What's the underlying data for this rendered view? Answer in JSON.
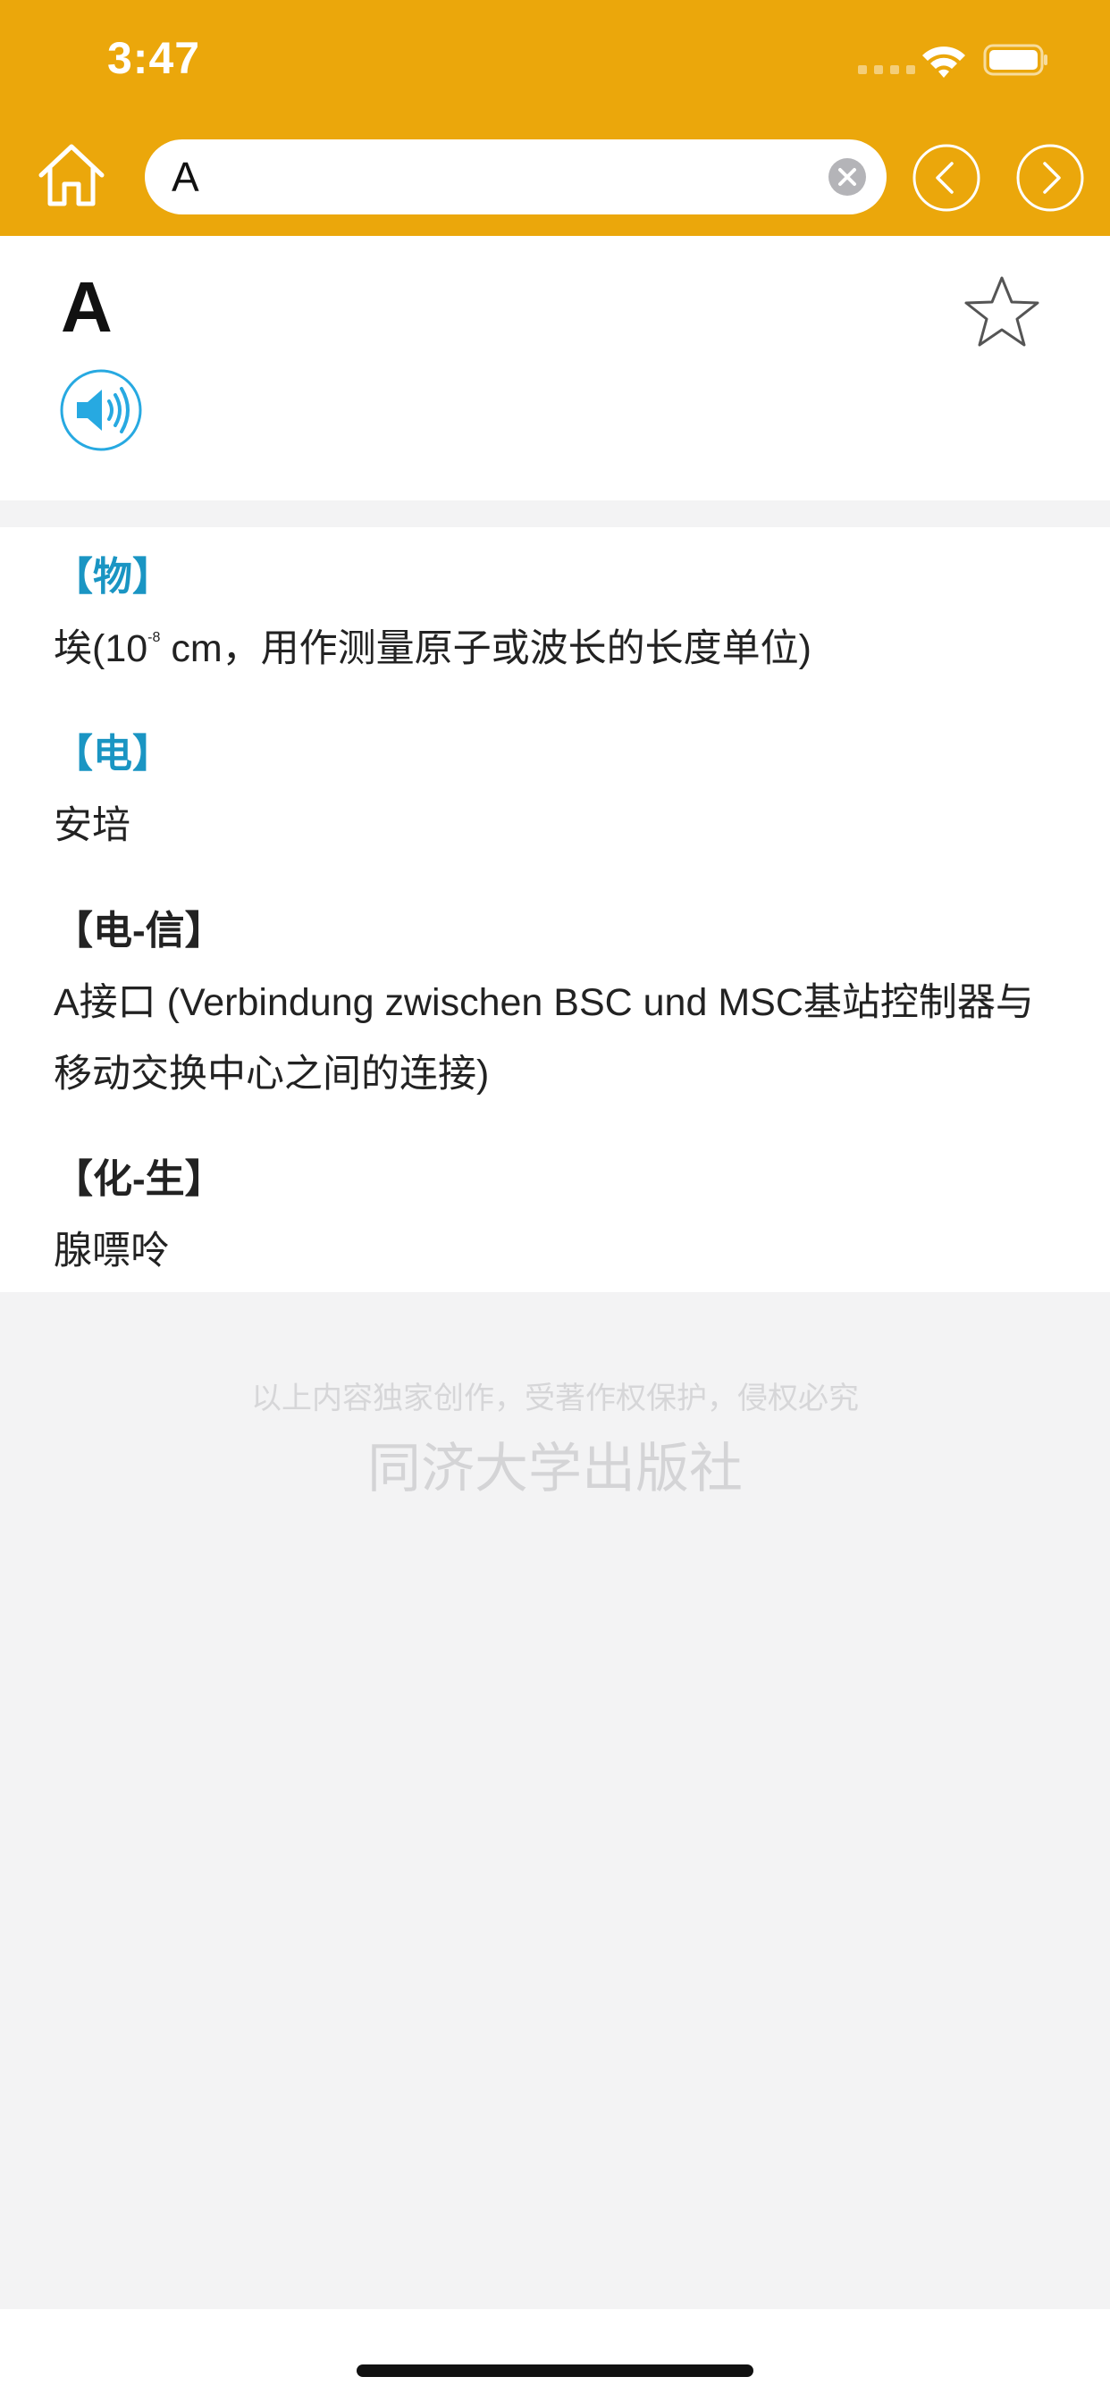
{
  "status_bar": {
    "time": "3:47"
  },
  "toolbar": {
    "search_value": "A"
  },
  "entry": {
    "headword": "A"
  },
  "definitions": [
    {
      "domain": "【物】",
      "gloss_before": "埃(10",
      "gloss_sup": "-8",
      "gloss_after": " cm，用作测量原子或波长的长度单位)"
    },
    {
      "domain": "【电】",
      "gloss": "安培"
    },
    {
      "domain": "【电-信】",
      "gloss": "A接口 (Verbindung zwischen BSC und MSC基站控制器与移动交换中心之间的连接)"
    },
    {
      "domain": "【化-生】",
      "gloss": "腺嘌呤"
    }
  ],
  "footer": {
    "copyright": "以上内容独家创作，受著作权保护，侵权必究",
    "publisher": "同济大学出版社"
  },
  "colors": {
    "header": "#eba70b",
    "domain_blue": "#1a95c3",
    "page_bg": "#f3f3f4"
  }
}
